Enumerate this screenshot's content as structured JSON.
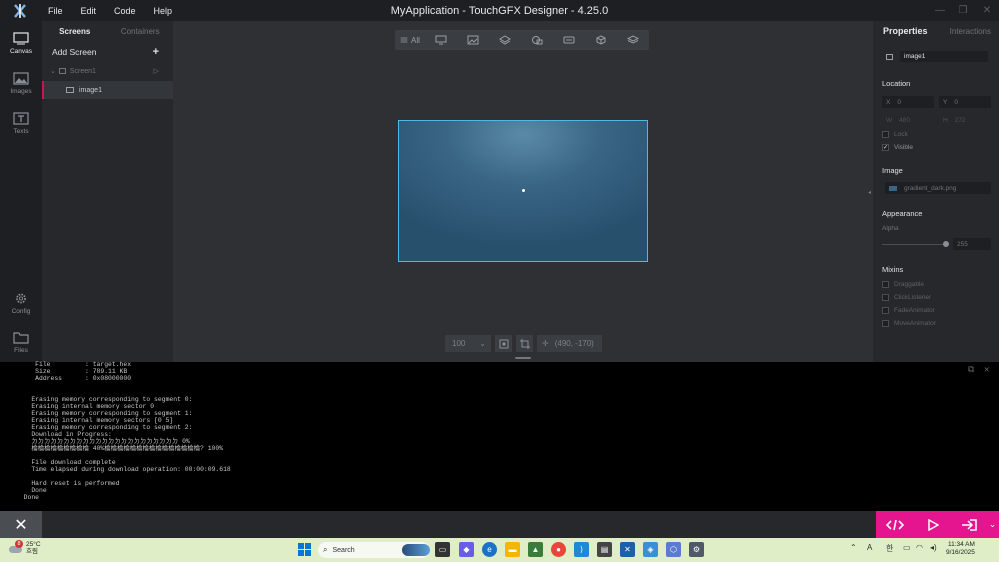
{
  "app": {
    "window_title": "MyApplication - TouchGFX Designer - 4.25.0",
    "menu": [
      "File",
      "Edit",
      "Code",
      "Help"
    ]
  },
  "rail": [
    {
      "label": "Canvas",
      "icon": "canvas-icon"
    },
    {
      "label": "Images",
      "icon": "images-icon"
    },
    {
      "label": "Texts",
      "icon": "texts-icon"
    },
    {
      "label": "Config",
      "icon": "gear-icon"
    },
    {
      "label": "Files",
      "icon": "folder-icon"
    }
  ],
  "screens_panel": {
    "tabs": [
      "Screens",
      "Containers"
    ],
    "add_screen": "Add Screen",
    "add_glyph": "+",
    "screen_name": "Screen1",
    "widget_name": "image1"
  },
  "toolbar": {
    "all_label": "All"
  },
  "canvas_bottom": {
    "zoom": "100",
    "coords": "(490, -170)"
  },
  "properties": {
    "tabs": [
      "Properties",
      "Interactions"
    ],
    "name": "image1",
    "location_title": "Location",
    "x_label": "X",
    "x_value": "0",
    "y_label": "Y",
    "y_value": "0",
    "w_label": "W",
    "w_value": "480",
    "h_label": "H",
    "h_value": "272",
    "lock_label": "Lock",
    "visible_label": "Visible",
    "image_title": "Image",
    "image_file": "gradient_dark.png",
    "appearance_title": "Appearance",
    "alpha_label": "Alpha",
    "alpha_value": "255",
    "mixins_title": "Mixins",
    "mixins": [
      "Draggable",
      "ClickListener",
      "FadeAnimator",
      "MoveAnimator"
    ]
  },
  "console": {
    "lines": [
      "     File         : target.hex",
      "     Size         : 789.11 KB",
      "     Address      : 0x08000000",
      "",
      "",
      "    Erasing memory corresponding to segment 0:",
      "    Erasing internal memory sector 0",
      "    Erasing memory corresponding to segment 1:",
      "    Erasing internal memory sectors [0 5]",
      "    Erasing memory corresponding to segment 2:",
      "    Download in Progress:",
      "    ㄉㄉㄉㄉㄉㄉㄉㄉㄉㄉㄉㄉㄉㄉㄉㄉㄉㄉㄉㄉㄉㄉㄉ 0%",
      "    棆棆棆棆棆棆棆棆棆 40%棆棆棆棆棆棆棆棆棆棆棆棆棆棆棆? 100%",
      "",
      "    File download complete",
      "    Time elapsed during download operation: 00:00:09.618",
      "",
      "    Hard reset is performed",
      "    Done",
      "  Done"
    ]
  },
  "taskbar": {
    "weather_temp": "25°C",
    "weather_desc": "흐림",
    "notification_count": "8",
    "search_label": "Search",
    "lang_label": "A",
    "ime_label": "한",
    "time": "11:34 AM",
    "date": "9/16/2025"
  },
  "colors": {
    "accent_pink": "#e5148f",
    "selection_blue": "#4fb8e8"
  }
}
